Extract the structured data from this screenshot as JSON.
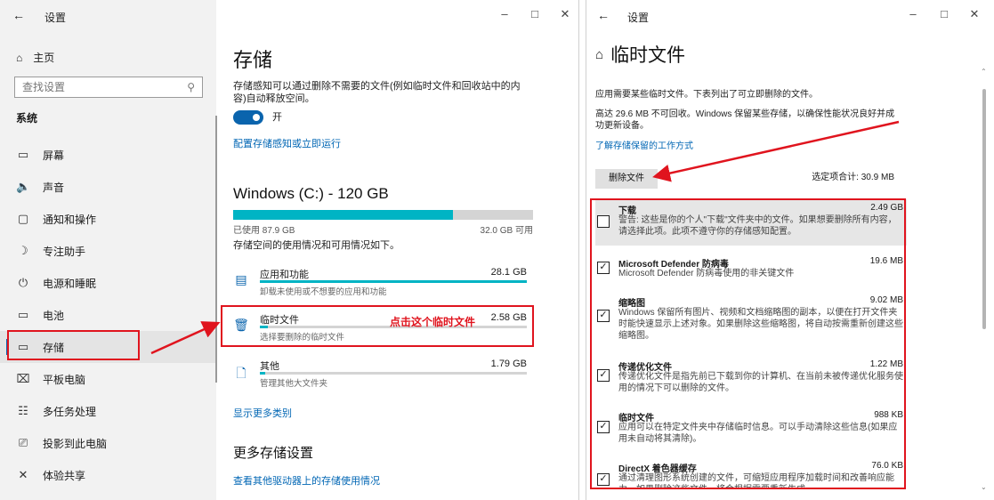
{
  "left_window": {
    "title": "设置",
    "controls": {
      "minimize": "–",
      "maximize": "□",
      "close": "✕"
    },
    "sidebar": {
      "home": "主页",
      "search_placeholder": "查找设置",
      "section": "系统",
      "items": [
        {
          "label": "屏幕",
          "icon": "monitor-icon"
        },
        {
          "label": "声音",
          "icon": "speaker-icon"
        },
        {
          "label": "通知和操作",
          "icon": "notification-icon"
        },
        {
          "label": "专注助手",
          "icon": "moon-icon"
        },
        {
          "label": "电源和睡眠",
          "icon": "power-icon"
        },
        {
          "label": "电池",
          "icon": "battery-icon"
        },
        {
          "label": "存储",
          "icon": "storage-icon",
          "active": true
        },
        {
          "label": "平板电脑",
          "icon": "tablet-icon"
        },
        {
          "label": "多任务处理",
          "icon": "multitask-icon"
        },
        {
          "label": "投影到此电脑",
          "icon": "project-icon"
        },
        {
          "label": "体验共享",
          "icon": "share-icon"
        }
      ]
    },
    "main": {
      "title": "存储",
      "sense_desc": "存储感知可以通过删除不需要的文件(例如临时文件和回收站中的内容)自动释放空间。",
      "toggle_label": "开",
      "sense_link": "配置存储感知或立即运行",
      "drive_title": "Windows (C:) - 120 GB",
      "used": "已使用 87.9 GB",
      "free": "32.0 GB 可用",
      "usage_fraction": 0.7325,
      "usage_desc": "存储空间的使用情况和可用情况如下。",
      "categories": [
        {
          "name": "应用和功能",
          "size": "28.1 GB",
          "desc": "卸载未使用或不想要的应用和功能",
          "fraction": 1.0
        },
        {
          "name": "临时文件",
          "size": "2.58 GB",
          "desc": "选择要删除的临时文件",
          "fraction": 0.03
        },
        {
          "name": "其他",
          "size": "1.79 GB",
          "desc": "管理其他大文件夹",
          "fraction": 0.02
        }
      ],
      "show_more": "显示更多类别",
      "more_title": "更多存储设置",
      "more_link": "查看其他驱动器上的存储使用情况"
    },
    "annotation": "点击这个临时文件"
  },
  "right_window": {
    "title": "设置",
    "controls": {
      "minimize": "–",
      "maximize": "□",
      "close": "✕"
    },
    "page_title": "临时文件",
    "intro": "应用需要某些临时文件。下表列出了可立即删除的文件。",
    "warning": "高达 29.6 MB 不可回收。Windows 保留某些存储，以确保性能状况良好并成功更新设备。",
    "learn_link": "了解存储保留的工作方式",
    "delete_button": "删除文件",
    "selected_total": "选定项合计: 30.9 MB",
    "items": [
      {
        "name": "下载",
        "size": "2.49 GB",
        "checked": false,
        "desc": "警告: 这些是你的个人\"下载\"文件夹中的文件。如果想要删除所有内容，请选择此项。此项不遵守你的存储感知配置。"
      },
      {
        "name": "Microsoft Defender 防病毒",
        "size": "19.6 MB",
        "checked": true,
        "desc": "Microsoft Defender 防病毒使用的非关键文件"
      },
      {
        "name": "缩略图",
        "size": "9.02 MB",
        "checked": true,
        "desc": "Windows 保留所有图片、视频和文档缩略图的副本，以便在打开文件夹时能快速显示上述对象。如果删除这些缩略图，将自动按需重新创建这些缩略图。"
      },
      {
        "name": "传递优化文件",
        "size": "1.22 MB",
        "checked": true,
        "desc": "传递优化文件是指先前已下载到你的计算机、在当前未被传递优化服务使用的情况下可以删除的文件。"
      },
      {
        "name": "临时文件",
        "size": "988 KB",
        "checked": true,
        "desc": "应用可以在特定文件夹中存储临时信息。可以手动清除这些信息(如果应用未自动将其清除)。"
      },
      {
        "name": "DirectX 着色器缓存",
        "size": "76.0 KB",
        "checked": true,
        "desc": "通过清理图形系统创建的文件，可缩短应用程序加载时间和改善响应能力。如果删除这些文件，将会根据需要重新生成。"
      }
    ]
  }
}
